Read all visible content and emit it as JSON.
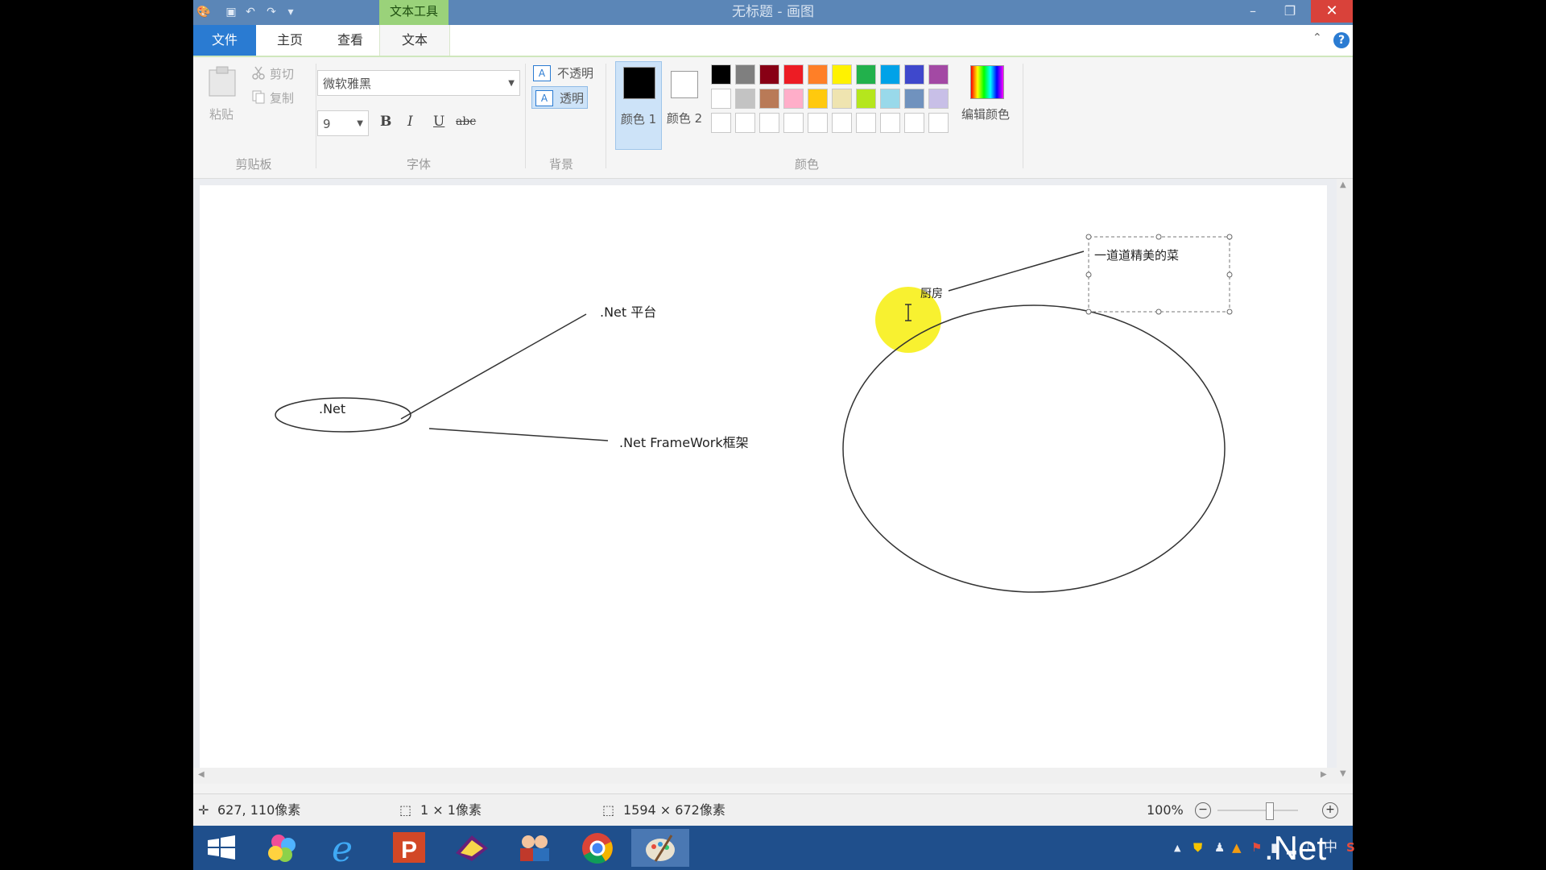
{
  "window": {
    "title": "无标题 - 画图",
    "context_tab": "文本工具",
    "controls": {
      "minimize": "–",
      "restore": "❐",
      "close": "✕"
    }
  },
  "quick_access": {
    "save": "▣",
    "undo": "↶",
    "redo": "↷",
    "customize": "▾"
  },
  "tabs": [
    {
      "label": "文件"
    },
    {
      "label": "主页"
    },
    {
      "label": "查看"
    },
    {
      "label": "文本"
    }
  ],
  "ribbon": {
    "clipboard": {
      "group": "剪贴板",
      "paste": "粘贴",
      "cut": "剪切",
      "copy": "复制"
    },
    "font": {
      "group": "字体",
      "family": "微软雅黑",
      "size": "9",
      "bold": "B",
      "italic": "I",
      "underline": "U",
      "strike": "abc"
    },
    "background": {
      "group": "背景",
      "opaque": "不透明",
      "transparent": "透明"
    },
    "colors": {
      "group": "颜色",
      "color1_label": "颜色 1",
      "color2_label": "颜色 2",
      "edit_label": "编辑颜色",
      "color1": "#000000",
      "color2": "#ffffff",
      "palette_row1": [
        "#000000",
        "#7f7f7f",
        "#880015",
        "#ed1c24",
        "#ff7f27",
        "#fff200",
        "#22b14c",
        "#00a2e8",
        "#3f48cc",
        "#a349a4"
      ],
      "palette_row2": [
        "#ffffff",
        "#c3c3c3",
        "#b97a57",
        "#ffaec9",
        "#ffc90e",
        "#efe4b0",
        "#b5e61d",
        "#99d9ea",
        "#7092be",
        "#c8bfe7"
      ],
      "palette_row3": [
        "#ffffff",
        "#ffffff",
        "#ffffff",
        "#ffffff",
        "#ffffff",
        "#ffffff",
        "#ffffff",
        "#ffffff",
        "#ffffff",
        "#ffffff"
      ]
    }
  },
  "canvas": {
    "net_label": ".Net",
    "platform_label": ".Net 平台",
    "framework_label": ".Net FrameWork框架",
    "kitchen_label": "厨房",
    "dish_label": "一道道精美的菜"
  },
  "status": {
    "cursor_pos": "627, 110像素",
    "selection_size": "1 × 1像素",
    "image_size": "1594 × 672像素",
    "zoom": "100%"
  },
  "tray": {
    "ime": "中",
    "brand": ".Net"
  }
}
